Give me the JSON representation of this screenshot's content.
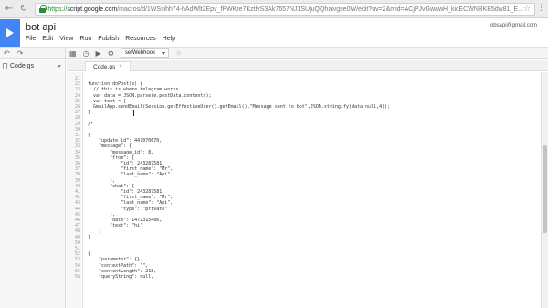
{
  "browser": {
    "url_scheme": "https://",
    "url_host": "script.google.com",
    "url_path": "/macros/d/1WSsihh74-hAdWlt2Epv_fPWKre7KztlvS3Ak7657NJ1SUjuQQhaivgse0W/edit?uv=2&mid=ACjPJvGwawH_kicECWNBKB5dw81_E..."
  },
  "app": {
    "title": "bot api",
    "menu": [
      "File",
      "Edit",
      "View",
      "Run",
      "Publish",
      "Resources",
      "Help"
    ],
    "user_email": "obsapi@gmail.com"
  },
  "toolbar": {
    "function_select": "setWebhook"
  },
  "sidebar": {
    "file": "Code.gs"
  },
  "editor": {
    "tab_label": "Code.gs",
    "lines": [
      {
        "n": "21",
        "code": ""
      },
      {
        "n": "22",
        "code": "function doPost(e) {"
      },
      {
        "n": "23",
        "code": "  // this is where telegram works"
      },
      {
        "n": "24",
        "code": "  var data = JSON.parse(e.postData.contents);"
      },
      {
        "n": "25",
        "code": "  var text = ["
      },
      {
        "n": "26",
        "code": "  GmailApp.sendEmail(Session.getEffectiveUser().getEmail(),\"Message sent to bot\",JSON.stringify(data,null,4));"
      },
      {
        "n": "27",
        "code": "}"
      },
      {
        "n": "28",
        "code": ""
      },
      {
        "n": "29",
        "code": "/*"
      },
      {
        "n": "30",
        "code": ""
      },
      {
        "n": "31",
        "code": "{"
      },
      {
        "n": "32",
        "code": "    \"update_id\": 447070670,"
      },
      {
        "n": "33",
        "code": "    \"message\": {"
      },
      {
        "n": "34",
        "code": "        \"message_id\": 8,"
      },
      {
        "n": "35",
        "code": "        \"from\": {"
      },
      {
        "n": "36",
        "code": "            \"id\": 243287581,"
      },
      {
        "n": "37",
        "code": "            \"first_name\": \"Mr\","
      },
      {
        "n": "38",
        "code": "            \"last_name\": \"Api\""
      },
      {
        "n": "39",
        "code": "        },"
      },
      {
        "n": "40",
        "code": "        \"chat\": {"
      },
      {
        "n": "41",
        "code": "            \"id\": 243287581,"
      },
      {
        "n": "42",
        "code": "            \"first_name\": \"Mr\","
      },
      {
        "n": "43",
        "code": "            \"last_name\": \"Api\","
      },
      {
        "n": "44",
        "code": "            \"type\": \"private\""
      },
      {
        "n": "45",
        "code": "        },"
      },
      {
        "n": "46",
        "code": "        \"date\": 1472315486,"
      },
      {
        "n": "47",
        "code": "        \"text\": \"hi\""
      },
      {
        "n": "48",
        "code": "    }"
      },
      {
        "n": "49",
        "code": "}"
      },
      {
        "n": "50",
        "code": ""
      },
      {
        "n": "51",
        "code": ""
      },
      {
        "n": "52",
        "code": "{"
      },
      {
        "n": "53",
        "code": "    \"parameter\": {},"
      },
      {
        "n": "54",
        "code": "    \"contextPath\": \"\","
      },
      {
        "n": "55",
        "code": "    \"contentLength\": 218,"
      },
      {
        "n": "56",
        "code": "    \"queryString\": null,"
      }
    ]
  }
}
